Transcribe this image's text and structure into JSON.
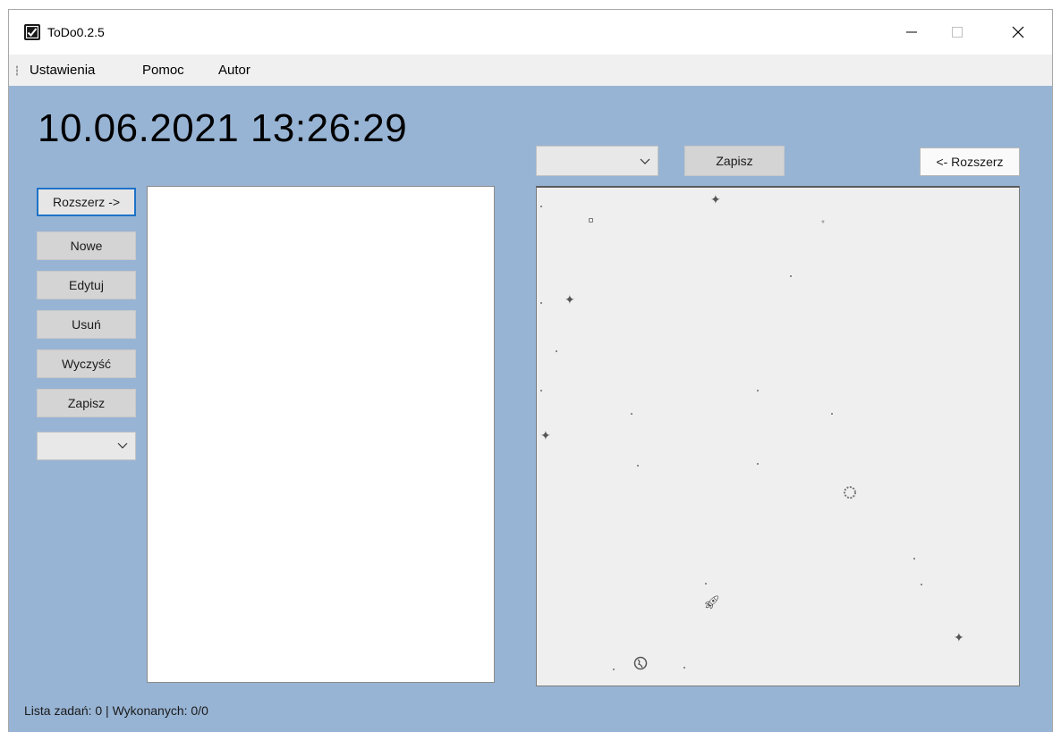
{
  "window": {
    "title": "ToDo0.2.5",
    "icon": "checkbox-icon",
    "controls": {
      "minimize": "minimize-icon",
      "maximize": "maximize-icon",
      "close": "close-icon"
    }
  },
  "menu": {
    "items": [
      {
        "label": "Ustawienia"
      },
      {
        "label": "Pomoc"
      },
      {
        "label": "Autor"
      }
    ]
  },
  "clock": {
    "text": "10.06.2021 13:26:29"
  },
  "left_panel": {
    "expand_button": "Rozszerz ->",
    "buttons": {
      "new": "Nowe",
      "edit": "Edytuj",
      "delete": "Usuń",
      "clear": "Wyczyść",
      "save": "Zapisz"
    },
    "combo_value": ""
  },
  "right_panel": {
    "combo_value": "",
    "save_button": "Zapisz",
    "collapse_button": "<- Rozszerz"
  },
  "status": {
    "text": "Lista zadań: 0 | Wykonanych: 0/0"
  },
  "colors": {
    "background": "#98b4d4",
    "focus_border": "#1c72c8",
    "canvas": "#efefef"
  }
}
